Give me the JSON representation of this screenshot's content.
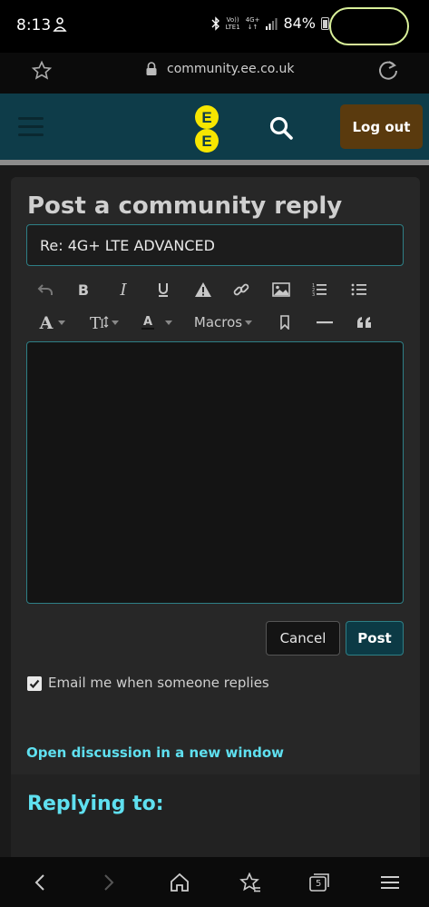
{
  "status_bar": {
    "time": "8:13",
    "net_top": "Vo))",
    "net_bottom": "LTE1",
    "gen_top": "4G+",
    "gen_bottom": "↓↑",
    "battery": "84%"
  },
  "browser": {
    "url": "community.ee.co.uk",
    "tab_count": "5"
  },
  "header": {
    "logo_line1": "E",
    "logo_line2": "E",
    "logout_label": "Log out"
  },
  "form": {
    "title": "Post a community reply",
    "subject_value": "Re: 4G+ LTE ADVANCED",
    "toolbar": {
      "macros_label": "Macros"
    },
    "cancel_label": "Cancel",
    "post_label": "Post",
    "email_label": "Email me when someone replies",
    "email_checked": true
  },
  "links": {
    "open_discussion": "Open discussion in a new window"
  },
  "replying": {
    "title": "Replying to:"
  },
  "colors": {
    "header_bg": "#0e3c49",
    "accent_teal": "#5fe0f0",
    "logout_bg": "#5a3a0e",
    "ee_yellow": "#f7e600"
  }
}
